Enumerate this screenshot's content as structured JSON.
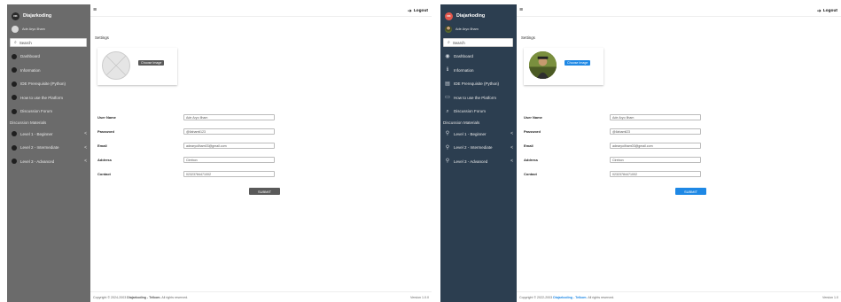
{
  "panels": [
    {
      "brand": {
        "logo_text": "DK",
        "name": "Diajarkoding"
      },
      "user": {
        "name": "Ade Aryo Ilham"
      },
      "search": {
        "label": "Search"
      },
      "menu": [
        {
          "label": "Dashboard",
          "icon": "dot-icon"
        },
        {
          "label": "Information",
          "icon": "dot-icon"
        },
        {
          "label": "IDE Prerequisite (Python)",
          "icon": "dot-icon"
        },
        {
          "label": "How to use the Platform",
          "icon": "dot-icon"
        },
        {
          "label": "Discussion Forum",
          "icon": "dot-icon"
        }
      ],
      "section_label": "Discussion Materials",
      "levels": [
        {
          "label": "Level 1 - Beginner",
          "chevron": "<"
        },
        {
          "label": "Level 2 - Intermediate",
          "chevron": "<"
        },
        {
          "label": "Level 3 - Advanced",
          "chevron": "<"
        }
      ],
      "topbar": {
        "menu_icon": "≡",
        "logout_label": "Logout",
        "logout_icon": "➔"
      },
      "settings_title": "Settings",
      "choose_image_label": "Choose Image",
      "form": {
        "fields": [
          {
            "label": "User Name",
            "value": "Ade Aryo Ilham"
          },
          {
            "label": "Password",
            "value": "@Ilahamil123"
          },
          {
            "label": "Email",
            "value": "adearyoilham03@gmail.com"
          },
          {
            "label": "Address",
            "value": "Cirebon"
          },
          {
            "label": "Contact",
            "value": "02323784471002"
          }
        ],
        "submit_label": "SUBMIT"
      },
      "footer": {
        "copyright_prefix": "Copyright © 2024-2003",
        "brand_link": "Diajarkoding - Telkom.",
        "rights": "All rights reserved.",
        "version": "Version 1.0.0"
      }
    },
    {
      "brand": {
        "logo_text": "DK",
        "name": "Diajarkoding"
      },
      "user": {
        "name": "Ade Aryo Ilham"
      },
      "search": {
        "label": "Search"
      },
      "menu": [
        {
          "label": "Dashboard",
          "icon": "◉"
        },
        {
          "label": "Information",
          "icon": "ℹ"
        },
        {
          "label": "IDE Prerequisite (Python)",
          "icon": "▤"
        },
        {
          "label": "How to use the Platform",
          "icon": "▭"
        },
        {
          "label": "Discussion Forum",
          "icon": "⌕"
        }
      ],
      "section_label": "Discussion Materials",
      "levels": [
        {
          "label": "Level 1 - Beginner",
          "chevron": "<"
        },
        {
          "label": "Level 2 - Intermediate",
          "chevron": "<"
        },
        {
          "label": "Level 3 - Advanced",
          "chevron": "<"
        }
      ],
      "topbar": {
        "menu_icon": "≡",
        "logout_label": "Logout",
        "logout_icon": "➔"
      },
      "settings_title": "Settings",
      "choose_image_label": "Choose Image",
      "form": {
        "fields": [
          {
            "label": "User Name",
            "value": "Ade Aryo Ilham"
          },
          {
            "label": "Password",
            "value": "@Ilahamil23"
          },
          {
            "label": "Email",
            "value": "adearyoilham03@gmail.com"
          },
          {
            "label": "Address",
            "value": "Cirebon"
          },
          {
            "label": "Contact",
            "value": "02323784471002"
          }
        ],
        "submit_label": "SUBMIT"
      },
      "footer": {
        "copyright_prefix": "Copyright © 2022-2003",
        "brand_link": "Diajarkoding - Telkom.",
        "rights": "All rights reserved.",
        "version": "Version 1.0"
      }
    }
  ],
  "colors": {
    "left_sidebar": "#6b6b6b",
    "right_sidebar": "#2c3e50",
    "accent_blue": "#1e88e5",
    "brand_red": "#e2574c"
  }
}
